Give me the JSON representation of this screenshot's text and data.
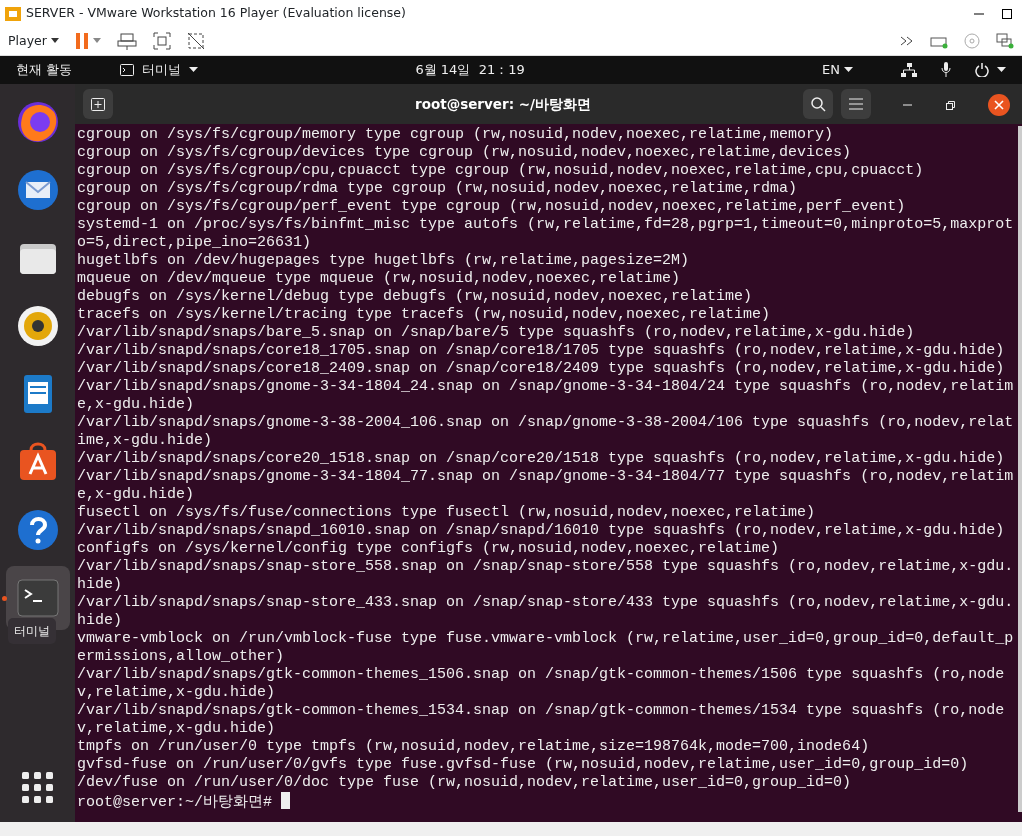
{
  "vmware": {
    "title": "SERVER - VMware Workstation 16 Player (Evaluation license)",
    "menu": "Player",
    "paused": false
  },
  "top_bar": {
    "activities": "현재 활동",
    "app_menu": "터미널",
    "clock": "6월 14일  21：19",
    "input_source": "EN"
  },
  "dock": [
    {
      "running": false
    },
    {
      "running": false
    },
    {
      "running": false
    },
    {
      "running": false
    },
    {
      "running": false
    },
    {
      "running": false
    },
    {
      "running": false
    },
    {
      "running": true
    }
  ],
  "dock_tooltip": "터미널",
  "terminal": {
    "title": "root@server: ~/바탕화면",
    "lines": [
      "cgroup on /sys/fs/cgroup/memory type cgroup (rw,nosuid,nodev,noexec,relatime,memory)",
      "cgroup on /sys/fs/cgroup/devices type cgroup (rw,nosuid,nodev,noexec,relatime,devices)",
      "cgroup on /sys/fs/cgroup/cpu,cpuacct type cgroup (rw,nosuid,nodev,noexec,relatime,cpu,cpuacct)",
      "cgroup on /sys/fs/cgroup/rdma type cgroup (rw,nosuid,nodev,noexec,relatime,rdma)",
      "cgroup on /sys/fs/cgroup/perf_event type cgroup (rw,nosuid,nodev,noexec,relatime,perf_event)",
      "systemd-1 on /proc/sys/fs/binfmt_misc type autofs (rw,relatime,fd=28,pgrp=1,timeout=0,minproto=5,maxproto=5,direct,pipe_ino=26631)",
      "hugetlbfs on /dev/hugepages type hugetlbfs (rw,relatime,pagesize=2M)",
      "mqueue on /dev/mqueue type mqueue (rw,nosuid,nodev,noexec,relatime)",
      "debugfs on /sys/kernel/debug type debugfs (rw,nosuid,nodev,noexec,relatime)",
      "tracefs on /sys/kernel/tracing type tracefs (rw,nosuid,nodev,noexec,relatime)",
      "/var/lib/snapd/snaps/bare_5.snap on /snap/bare/5 type squashfs (ro,nodev,relatime,x-gdu.hide)",
      "/var/lib/snapd/snaps/core18_1705.snap on /snap/core18/1705 type squashfs (ro,nodev,relatime,x-gdu.hide)",
      "/var/lib/snapd/snaps/core18_2409.snap on /snap/core18/2409 type squashfs (ro,nodev,relatime,x-gdu.hide)",
      "/var/lib/snapd/snaps/gnome-3-34-1804_24.snap on /snap/gnome-3-34-1804/24 type squashfs (ro,nodev,relatime,x-gdu.hide)",
      "/var/lib/snapd/snaps/gnome-3-38-2004_106.snap on /snap/gnome-3-38-2004/106 type squashfs (ro,nodev,relatime,x-gdu.hide)",
      "/var/lib/snapd/snaps/core20_1518.snap on /snap/core20/1518 type squashfs (ro,nodev,relatime,x-gdu.hide)",
      "/var/lib/snapd/snaps/gnome-3-34-1804_77.snap on /snap/gnome-3-34-1804/77 type squashfs (ro,nodev,relatime,x-gdu.hide)",
      "fusectl on /sys/fs/fuse/connections type fusectl (rw,nosuid,nodev,noexec,relatime)",
      "/var/lib/snapd/snaps/snapd_16010.snap on /snap/snapd/16010 type squashfs (ro,nodev,relatime,x-gdu.hide)",
      "configfs on /sys/kernel/config type configfs (rw,nosuid,nodev,noexec,relatime)",
      "/var/lib/snapd/snaps/snap-store_558.snap on /snap/snap-store/558 type squashfs (ro,nodev,relatime,x-gdu.hide)",
      "/var/lib/snapd/snaps/snap-store_433.snap on /snap/snap-store/433 type squashfs (ro,nodev,relatime,x-gdu.hide)",
      "vmware-vmblock on /run/vmblock-fuse type fuse.vmware-vmblock (rw,relatime,user_id=0,group_id=0,default_permissions,allow_other)",
      "/var/lib/snapd/snaps/gtk-common-themes_1506.snap on /snap/gtk-common-themes/1506 type squashfs (ro,nodev,relatime,x-gdu.hide)",
      "/var/lib/snapd/snaps/gtk-common-themes_1534.snap on /snap/gtk-common-themes/1534 type squashfs (ro,nodev,relatime,x-gdu.hide)",
      "tmpfs on /run/user/0 type tmpfs (rw,nosuid,nodev,relatime,size=198764k,mode=700,inode64)",
      "gvfsd-fuse on /run/user/0/gvfs type fuse.gvfsd-fuse (rw,nosuid,nodev,relatime,user_id=0,group_id=0)",
      "/dev/fuse on /run/user/0/doc type fuse (rw,nosuid,nodev,relatime,user_id=0,group_id=0)"
    ],
    "prompt": "root@server:~/바탕화면#"
  }
}
